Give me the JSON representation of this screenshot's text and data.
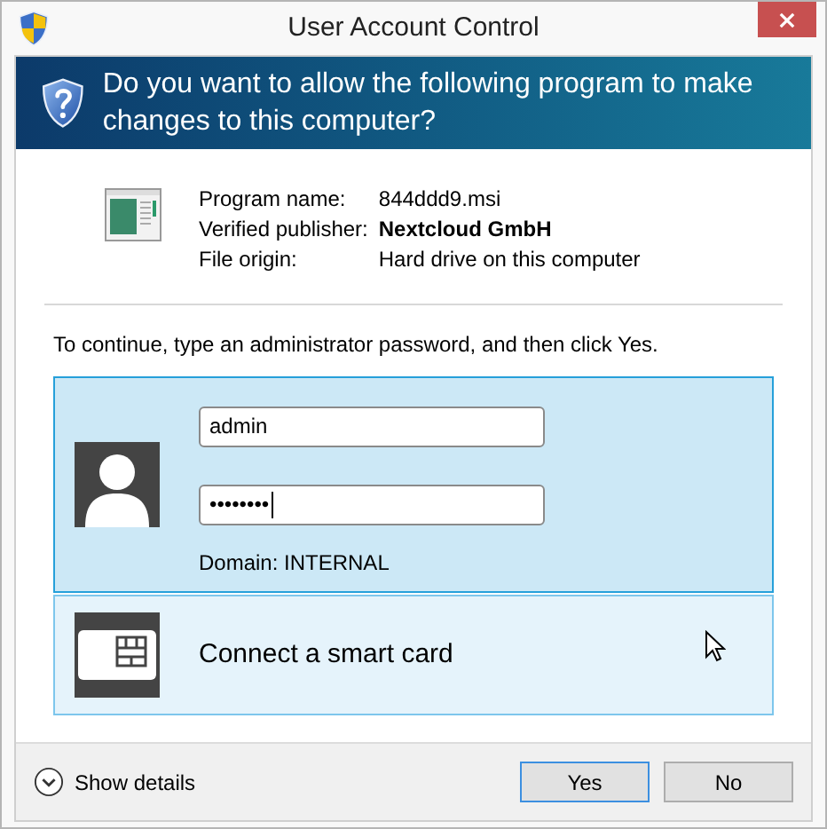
{
  "window": {
    "title": "User Account Control"
  },
  "header": {
    "question": "Do you want to allow the following program to make changes to this computer?"
  },
  "program": {
    "fields": [
      {
        "label": "Program name:",
        "value": "844ddd9.msi",
        "bold": false
      },
      {
        "label": "Verified publisher:",
        "value": "Nextcloud GmbH",
        "bold": true
      },
      {
        "label": "File origin:",
        "value": "Hard drive on this computer",
        "bold": false
      }
    ]
  },
  "instruction": "To continue, type an administrator password, and then click Yes.",
  "credentials": [
    {
      "kind": "password",
      "selected": true,
      "username": "admin",
      "password": "••••••••",
      "domain": "Domain: INTERNAL"
    },
    {
      "kind": "smartcard",
      "selected": false,
      "label": "Connect a smart card"
    }
  ],
  "footer": {
    "details": "Show details",
    "buttons": [
      {
        "label": "Yes",
        "default": true
      },
      {
        "label": "No",
        "default": false
      }
    ]
  }
}
